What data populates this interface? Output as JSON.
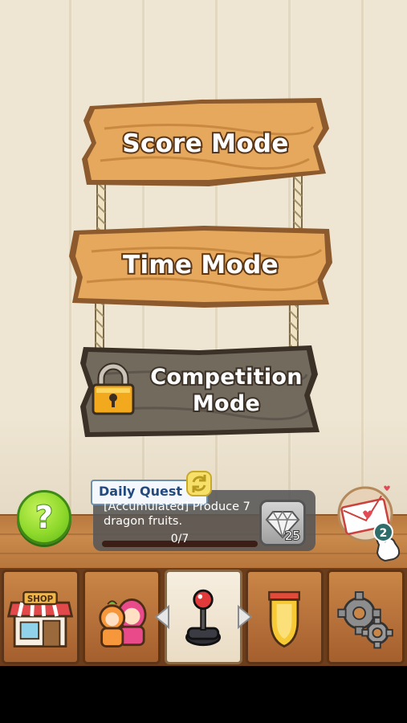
{
  "menu": {
    "score_mode": "Score Mode",
    "time_mode": "Time Mode",
    "competition_mode_line1": "Competition",
    "competition_mode_line2": "Mode",
    "competition_locked": true
  },
  "daily_quest": {
    "title": "Daily Quest",
    "description": "[Accumulated] Produce 7 dragon fruits.",
    "progress_text": "0/7",
    "progress_value": 0,
    "progress_total": 7,
    "reward_icon": "diamond-icon",
    "reward_amount": "25"
  },
  "help": {
    "label": "?"
  },
  "mail": {
    "badge_count": "2",
    "icon": "mail-heart-icon"
  },
  "navbar": {
    "items": [
      {
        "id": "shop",
        "icon": "shop-icon",
        "label": "SHOP"
      },
      {
        "id": "friends",
        "icon": "characters-icon"
      },
      {
        "id": "play",
        "icon": "joystick-icon",
        "active": true
      },
      {
        "id": "achievements",
        "icon": "medal-icon"
      },
      {
        "id": "settings",
        "icon": "gears-icon"
      }
    ]
  },
  "colors": {
    "wood": "#e0a45a",
    "wood_dark": "#8c5a2d",
    "locked_wood": "#6f655a",
    "help_green": "#8fd92c",
    "quest_title": "#234a7e"
  }
}
